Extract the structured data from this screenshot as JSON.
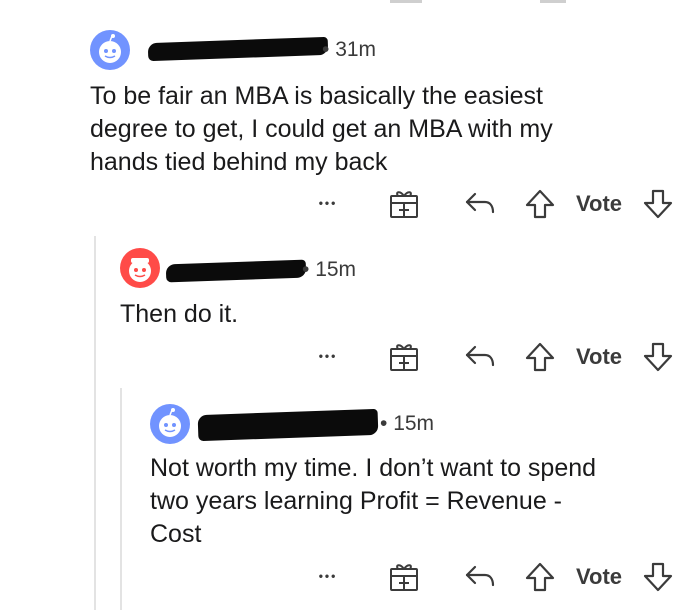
{
  "comments": [
    {
      "time": "31m",
      "body_lines": [
        "To be fair an MBA is basically the easiest",
        "degree to get, I could get an MBA with my",
        "hands tied behind my back"
      ],
      "vote_label": "Vote"
    },
    {
      "time": "15m",
      "body_lines": [
        "Then do it."
      ],
      "vote_label": "Vote"
    },
    {
      "time": "15m",
      "body_lines": [
        "Not worth my time. I don’t want to spend",
        "two years learning Profit = Revenue -",
        "Cost"
      ],
      "vote_label": "Vote"
    }
  ],
  "meta_separator": "•",
  "more_label": "•••",
  "colors": {
    "avatar_blue": "#7193ff",
    "avatar_red": "#ff4b48",
    "text": "#1a1a1b",
    "icon": "#3b3b3b",
    "thread_line": "#e3e3e3"
  },
  "icons": [
    "snoo-avatar-icon",
    "gift-award-icon",
    "reply-icon",
    "upvote-icon",
    "downvote-icon",
    "more-options-icon"
  ]
}
